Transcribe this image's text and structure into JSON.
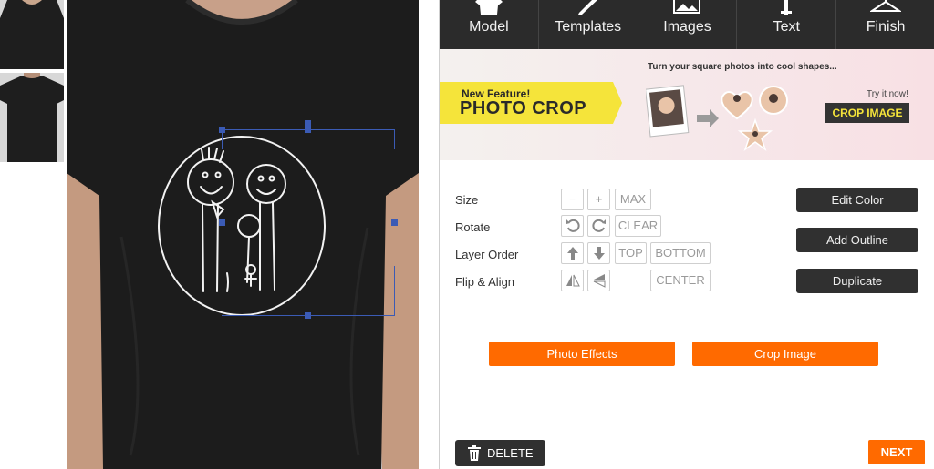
{
  "tabs": [
    {
      "label": "Model",
      "icon": "shirt-icon"
    },
    {
      "label": "Templates",
      "icon": "pencil-icon"
    },
    {
      "label": "Images",
      "icon": "image-icon"
    },
    {
      "label": "Text",
      "icon": "text-icon"
    },
    {
      "label": "Finish",
      "icon": "hanger-icon"
    }
  ],
  "banner": {
    "tagline": "Turn your square photos into cool shapes...",
    "new_feature": "New Feature!",
    "headline": "PHOTO CROP",
    "try_it": "Try it now!",
    "button": "CROP IMAGE",
    "accent": "#f5e43a"
  },
  "tools": {
    "size": {
      "label": "Size",
      "minus": "−",
      "plus": "+",
      "max": "MAX"
    },
    "rotate": {
      "label": "Rotate",
      "ccw_icon": "rotate-left-icon",
      "cw_icon": "rotate-right-icon",
      "clear": "CLEAR"
    },
    "layer": {
      "label": "Layer Order",
      "up_icon": "arrow-up-icon",
      "down_icon": "arrow-down-icon",
      "top": "TOP",
      "bottom": "BOTTOM"
    },
    "flip": {
      "label": "Flip & Align",
      "h_icon": "flip-horizontal-icon",
      "v_icon": "flip-vertical-icon",
      "center": "CENTER"
    }
  },
  "side_buttons": {
    "edit_color": "Edit Color",
    "add_outline": "Add Outline",
    "duplicate": "Duplicate"
  },
  "actions": {
    "photo_effects": "Photo Effects",
    "crop_image": "Crop Image"
  },
  "footer": {
    "delete": "DELETE",
    "next": "NEXT"
  },
  "colors": {
    "accent": "#ff6a00",
    "dark": "#303030",
    "selection": "#3b5bb5"
  }
}
